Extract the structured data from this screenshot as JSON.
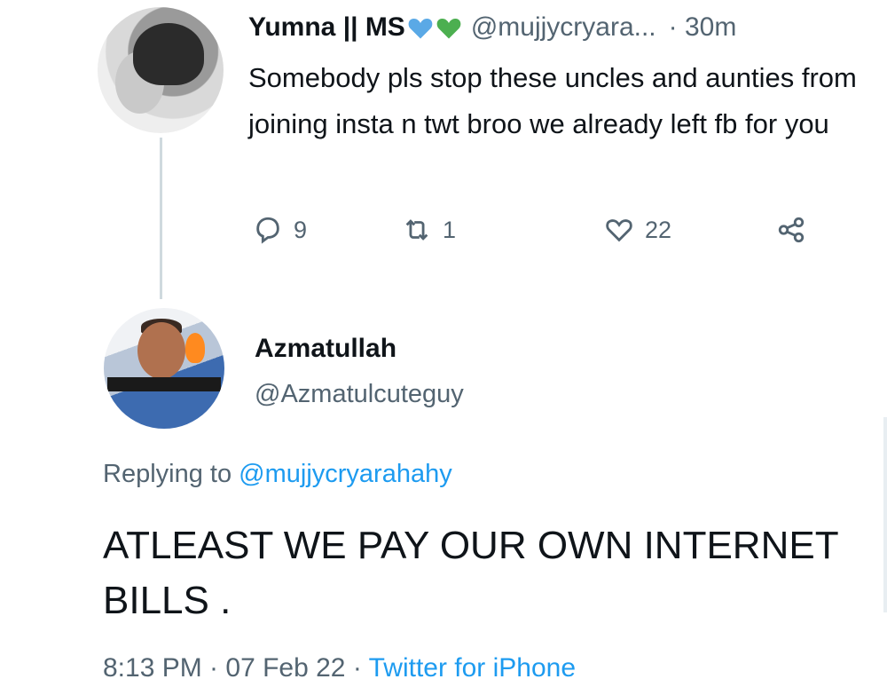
{
  "tweet": {
    "author_name": "Yumna || MS",
    "author_handle": "@mujjycryara...",
    "time": "· 30m",
    "text": "Somebody pls stop these uncles and aunties from joining insta n twt broo we already left fb for you",
    "heart_colors": [
      "#5aa9e6",
      "#4caf50"
    ],
    "actions": {
      "reply_icon": "comment-icon",
      "reply_count": "9",
      "retweet_icon": "retweet-icon",
      "retweet_count": "1",
      "like_icon": "heart-icon",
      "like_count": "22",
      "share_icon": "share-icon"
    }
  },
  "reply": {
    "author_name": "Azmatullah",
    "author_handle": "@Azmatulcuteguy",
    "replying_prefix": "Replying to",
    "replying_to": "@mujjycryarahahy",
    "text": "ATLEAST WE PAY OUR OWN INTERNET BILLS .",
    "timestamp": "8:13 PM · 07 Feb 22 ·",
    "source": "Twitter for iPhone"
  },
  "colors": {
    "secondary_text": "#536471",
    "link": "#1d9bf0"
  }
}
